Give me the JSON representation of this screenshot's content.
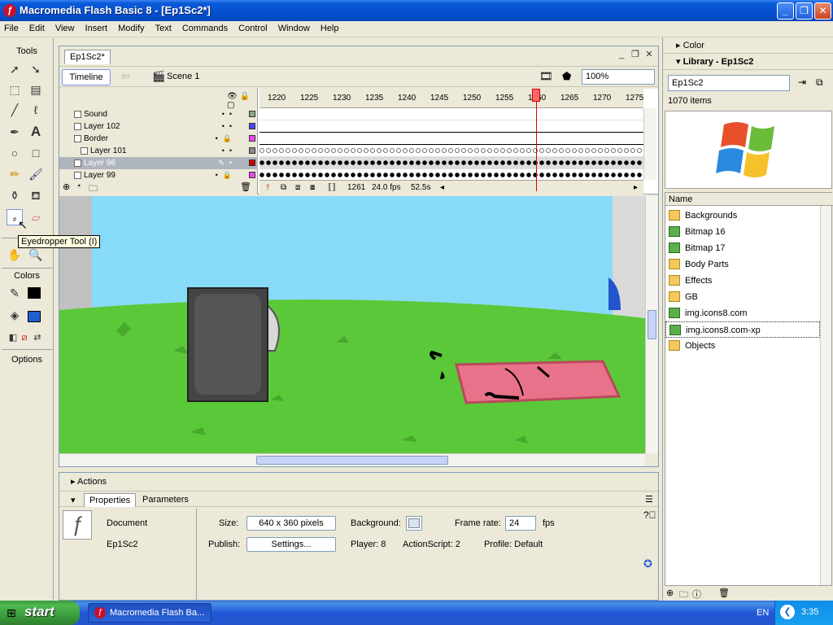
{
  "window": {
    "title": "Macromedia Flash Basic 8 - [Ep1Sc2*]",
    "app_icon_glyph": "ƒ",
    "controls": [
      "_",
      "❐",
      "✕"
    ]
  },
  "menu": [
    "File",
    "Edit",
    "View",
    "Insert",
    "Modify",
    "Text",
    "Commands",
    "Control",
    "Window",
    "Help"
  ],
  "tools": {
    "title": "Tools",
    "colors_label": "Colors",
    "options_label": "Options",
    "tooltip": "Eyedropper Tool (I)",
    "stroke_color": "#000000",
    "fill_color": "#1f5fd0"
  },
  "document": {
    "tab": "Ep1Sc2*",
    "timeline_button": "Timeline",
    "scene": "Scene 1",
    "zoom": "100%",
    "ruler": [
      "1220",
      "1225",
      "1230",
      "1235",
      "1240",
      "1245",
      "1250",
      "1255",
      "1260",
      "1265",
      "1270",
      "1275"
    ],
    "layers": [
      {
        "name": "Sound"
      },
      {
        "name": "Layer 102"
      },
      {
        "name": "Border"
      },
      {
        "name": "Layer 101"
      },
      {
        "name": "Layer 96"
      },
      {
        "name": "Layer 99"
      }
    ],
    "current_frame": "1261",
    "fps": "24.0 fps",
    "elapsed": "52.5s"
  },
  "panels": {
    "color": "Color",
    "library_title": "Library - Ep1Sc2",
    "library_select": "Ep1Sc2",
    "item_count": "1070 items",
    "name_header": "Name",
    "items": [
      {
        "name": "Backgrounds",
        "type": "folder"
      },
      {
        "name": "Bitmap 16",
        "type": "bitmap"
      },
      {
        "name": "Bitmap 17",
        "type": "bitmap"
      },
      {
        "name": "Body Parts",
        "type": "folder"
      },
      {
        "name": "Effects",
        "type": "folder"
      },
      {
        "name": "GB",
        "type": "folder"
      },
      {
        "name": "img.icons8.com",
        "type": "bitmap"
      },
      {
        "name": "img.icons8.com-xp",
        "type": "bitmap"
      },
      {
        "name": "Objects",
        "type": "folder"
      }
    ]
  },
  "properties": {
    "actions": "Actions",
    "tab_properties": "Properties",
    "tab_parameters": "Parameters",
    "doc_label": "Document",
    "doc_name": "Ep1Sc2",
    "size_label": "Size:",
    "size_value": "640 x 360 pixels",
    "background_label": "Background:",
    "framerate_label": "Frame rate:",
    "framerate_value": "24",
    "fps_unit": "fps",
    "publish_label": "Publish:",
    "settings_button": "Settings...",
    "player": "Player: 8",
    "actionscript": "ActionScript:  2",
    "profile": "Profile:  Default"
  },
  "taskbar": {
    "start": "start",
    "task": "Macromedia Flash Ba...",
    "lang": "EN",
    "time": "3:35"
  }
}
